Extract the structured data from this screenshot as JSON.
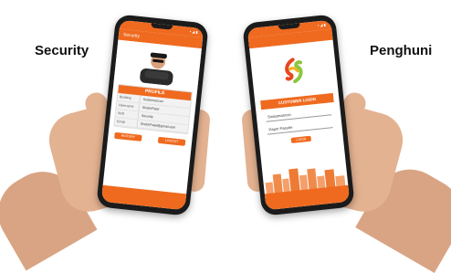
{
  "labels": {
    "left": "Security",
    "right": "Penghuni"
  },
  "colors": {
    "accent": "#ef6a1f",
    "skin": "#e3b291",
    "dark": "#1b1b1b"
  },
  "security_app": {
    "title": "Security",
    "profile": {
      "header": "PROFILE",
      "rows": [
        {
          "key": "Building",
          "value": "Swissmancon"
        },
        {
          "key": "Username",
          "value": "ShobhPatel"
        },
        {
          "key": "Shift",
          "value": "Security"
        },
        {
          "key": "Email",
          "value": "ShobhPatel@gmail.com"
        }
      ]
    },
    "buttons": {
      "left": "HISTORY",
      "right": "LOGOUT"
    }
  },
  "resident_app": {
    "login": {
      "header": "CUSTOMER LOGIN",
      "building_value": "Swissmancon",
      "password_value": "Papm Passhe",
      "button": "LOGIN"
    }
  }
}
